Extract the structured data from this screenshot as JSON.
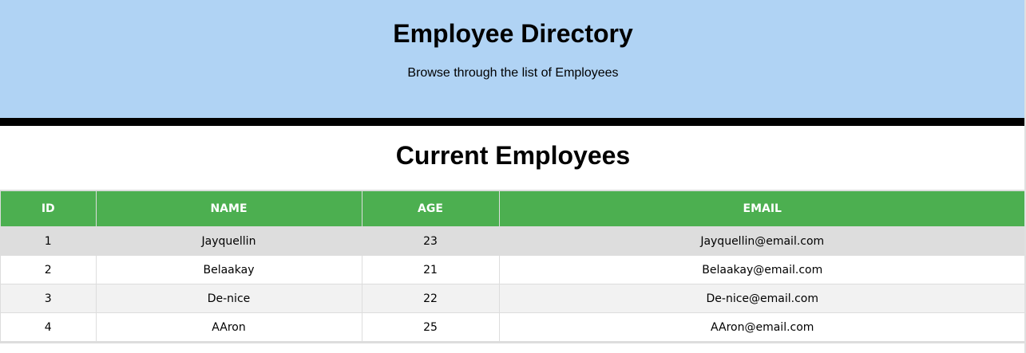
{
  "header": {
    "title": "Employee Directory",
    "subtitle": "Browse through the list of Employees"
  },
  "main": {
    "section_title": "Current Employees",
    "table": {
      "columns": [
        "ID",
        "NAME",
        "AGE",
        "EMAIL"
      ],
      "rows": [
        {
          "id": "1",
          "name": "Jayquellin",
          "age": "23",
          "email": "Jayquellin@email.com"
        },
        {
          "id": "2",
          "name": "Belaakay",
          "age": "21",
          "email": "Belaakay@email.com"
        },
        {
          "id": "3",
          "name": "De-nice",
          "age": "22",
          "email": "De-nice@email.com"
        },
        {
          "id": "4",
          "name": "AAron",
          "age": "25",
          "email": "AAron@email.com"
        }
      ]
    }
  },
  "colors": {
    "header_bg": "#b0d3f4",
    "table_header_bg": "#4caf50",
    "divider": "#000000"
  }
}
